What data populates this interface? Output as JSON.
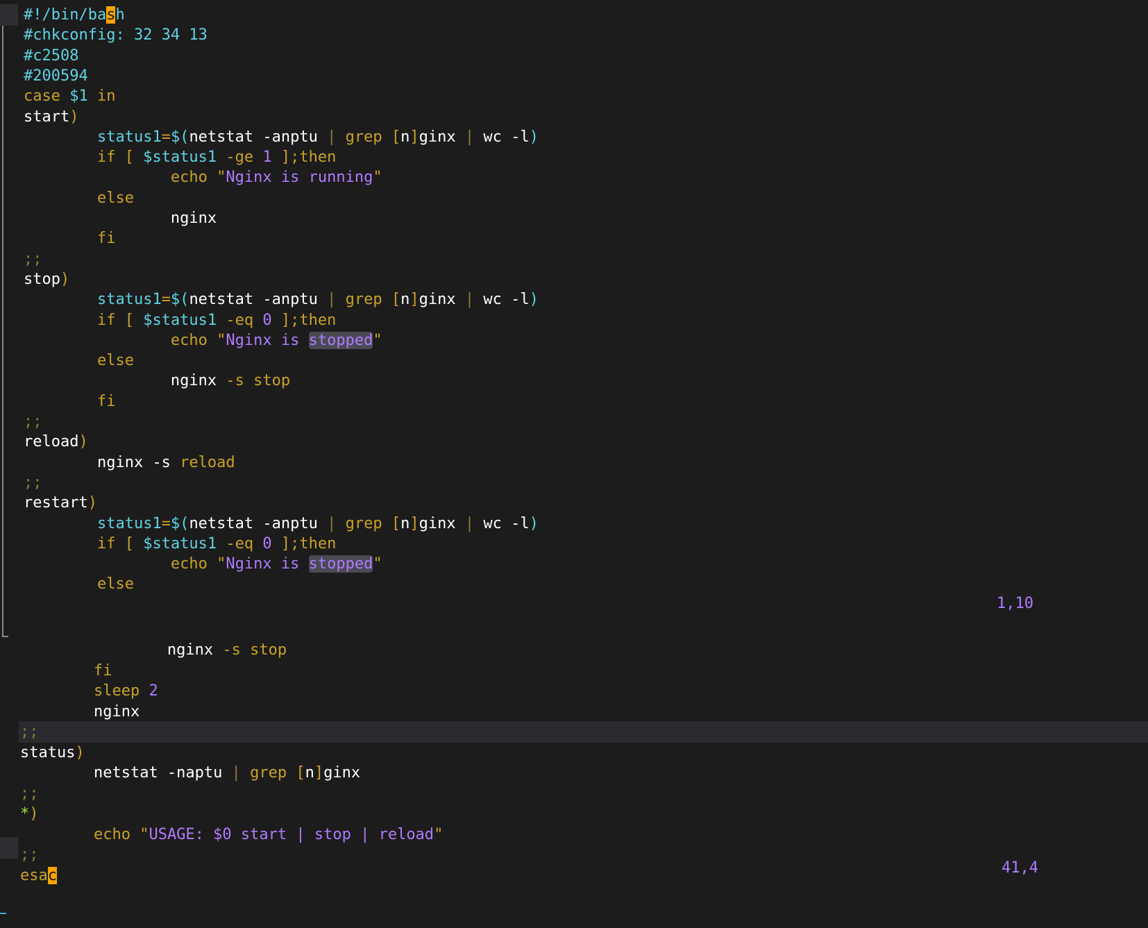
{
  "colors": {
    "background": "#1c1c1c",
    "comment": "#5fd3e3",
    "keyword": "#c9a227",
    "string_text": "#b07bff",
    "cursor": "#f5a300",
    "search_highlight": "#4a4a52"
  },
  "top_window": {
    "ruler": "1,10",
    "lines": [
      [
        {
          "t": "#!/bin/ba",
          "c": "cmt"
        },
        {
          "t": "s",
          "c": "cursor"
        },
        {
          "t": "h",
          "c": "cmt"
        }
      ],
      [
        {
          "t": "#chkconfig: 32 34 13",
          "c": "cmt"
        }
      ],
      [
        {
          "t": "#c2508",
          "c": "cmt"
        }
      ],
      [
        {
          "t": "#200594",
          "c": "cmt"
        }
      ],
      [
        {
          "t": "case ",
          "c": "kw"
        },
        {
          "t": "$1",
          "c": "var"
        },
        {
          "t": " in",
          "c": "kw"
        }
      ],
      [
        {
          "t": "start",
          "c": "fn"
        },
        {
          "t": ")",
          "c": "op"
        }
      ],
      [
        {
          "t": "        "
        },
        {
          "t": "status1",
          "c": "var"
        },
        {
          "t": "=",
          "c": "op"
        },
        {
          "t": "$(",
          "c": "var"
        },
        {
          "t": "netstat -anptu ",
          "c": "fn"
        },
        {
          "t": "|",
          "c": "dim"
        },
        {
          "t": " grep ",
          "c": "kw"
        },
        {
          "t": "[",
          "c": "op"
        },
        {
          "t": "n",
          "c": "fn"
        },
        {
          "t": "]",
          "c": "op"
        },
        {
          "t": "ginx ",
          "c": "fn"
        },
        {
          "t": "|",
          "c": "dim"
        },
        {
          "t": " wc -l",
          "c": "fn"
        },
        {
          "t": ")",
          "c": "var"
        }
      ],
      [
        {
          "t": "        "
        },
        {
          "t": "if [ ",
          "c": "kw"
        },
        {
          "t": "$status1",
          "c": "var"
        },
        {
          "t": " -ge ",
          "c": "kw"
        },
        {
          "t": "1",
          "c": "num"
        },
        {
          "t": " ];then",
          "c": "kw"
        }
      ],
      [
        {
          "t": "                "
        },
        {
          "t": "echo ",
          "c": "kw"
        },
        {
          "t": "\"",
          "c": "str"
        },
        {
          "t": "Nginx is running",
          "c": "strin"
        },
        {
          "t": "\"",
          "c": "str"
        }
      ],
      [
        {
          "t": "        "
        },
        {
          "t": "else",
          "c": "kw"
        }
      ],
      [
        {
          "t": "                "
        },
        {
          "t": "nginx",
          "c": "fn"
        }
      ],
      [
        {
          "t": "        "
        },
        {
          "t": "fi",
          "c": "kw"
        }
      ],
      [
        {
          "t": ";;",
          "c": "dim"
        }
      ],
      [
        {
          "t": "stop",
          "c": "fn"
        },
        {
          "t": ")",
          "c": "op"
        }
      ],
      [
        {
          "t": "        "
        },
        {
          "t": "status1",
          "c": "var"
        },
        {
          "t": "=",
          "c": "op"
        },
        {
          "t": "$(",
          "c": "var"
        },
        {
          "t": "netstat -anptu ",
          "c": "fn"
        },
        {
          "t": "|",
          "c": "dim"
        },
        {
          "t": " grep ",
          "c": "kw"
        },
        {
          "t": "[",
          "c": "op"
        },
        {
          "t": "n",
          "c": "fn"
        },
        {
          "t": "]",
          "c": "op"
        },
        {
          "t": "ginx ",
          "c": "fn"
        },
        {
          "t": "|",
          "c": "dim"
        },
        {
          "t": " wc -l",
          "c": "fn"
        },
        {
          "t": ")",
          "c": "var"
        }
      ],
      [
        {
          "t": "        "
        },
        {
          "t": "if [ ",
          "c": "kw"
        },
        {
          "t": "$status1",
          "c": "var"
        },
        {
          "t": " -eq ",
          "c": "kw"
        },
        {
          "t": "0",
          "c": "num"
        },
        {
          "t": " ];then",
          "c": "kw"
        }
      ],
      [
        {
          "t": "                "
        },
        {
          "t": "echo ",
          "c": "kw"
        },
        {
          "t": "\"",
          "c": "str"
        },
        {
          "t": "Nginx is ",
          "c": "strin"
        },
        {
          "t": "stopped",
          "c": "hl"
        },
        {
          "t": "\"",
          "c": "str"
        }
      ],
      [
        {
          "t": "        "
        },
        {
          "t": "else",
          "c": "kw"
        }
      ],
      [
        {
          "t": "                "
        },
        {
          "t": "nginx ",
          "c": "fn"
        },
        {
          "t": "-s stop",
          "c": "kw"
        }
      ],
      [
        {
          "t": "        "
        },
        {
          "t": "fi",
          "c": "kw"
        }
      ],
      [
        {
          "t": ";;",
          "c": "dim"
        }
      ],
      [
        {
          "t": "reload",
          "c": "fn"
        },
        {
          "t": ")",
          "c": "op"
        }
      ],
      [
        {
          "t": "        "
        },
        {
          "t": "nginx -s ",
          "c": "fn"
        },
        {
          "t": "reload",
          "c": "kw"
        }
      ],
      [
        {
          "t": ";;",
          "c": "dim"
        }
      ],
      [
        {
          "t": "restart",
          "c": "fn"
        },
        {
          "t": ")",
          "c": "op"
        }
      ],
      [
        {
          "t": "        "
        },
        {
          "t": "status1",
          "c": "var"
        },
        {
          "t": "=",
          "c": "op"
        },
        {
          "t": "$(",
          "c": "var"
        },
        {
          "t": "netstat -anptu ",
          "c": "fn"
        },
        {
          "t": "|",
          "c": "dim"
        },
        {
          "t": " grep ",
          "c": "kw"
        },
        {
          "t": "[",
          "c": "op"
        },
        {
          "t": "n",
          "c": "fn"
        },
        {
          "t": "]",
          "c": "op"
        },
        {
          "t": "ginx ",
          "c": "fn"
        },
        {
          "t": "|",
          "c": "dim"
        },
        {
          "t": " wc -l",
          "c": "fn"
        },
        {
          "t": ")",
          "c": "var"
        }
      ],
      [
        {
          "t": "        "
        },
        {
          "t": "if [ ",
          "c": "kw"
        },
        {
          "t": "$status1",
          "c": "var"
        },
        {
          "t": " -eq ",
          "c": "kw"
        },
        {
          "t": "0",
          "c": "num"
        },
        {
          "t": " ];then",
          "c": "kw"
        }
      ],
      [
        {
          "t": "                "
        },
        {
          "t": "echo ",
          "c": "kw"
        },
        {
          "t": "\"",
          "c": "str"
        },
        {
          "t": "Nginx is ",
          "c": "strin"
        },
        {
          "t": "stopped",
          "c": "hl"
        },
        {
          "t": "\"",
          "c": "str"
        }
      ],
      [
        {
          "t": "        "
        },
        {
          "t": "else",
          "c": "kw"
        }
      ]
    ]
  },
  "bottom_window": {
    "ruler": "41,4",
    "lines": [
      [
        {
          "t": "                "
        },
        {
          "t": "nginx ",
          "c": "fn"
        },
        {
          "t": "-s stop",
          "c": "kw"
        }
      ],
      [
        {
          "t": "        "
        },
        {
          "t": "fi",
          "c": "kw"
        }
      ],
      [
        {
          "t": "        "
        },
        {
          "t": "sleep ",
          "c": "kw"
        },
        {
          "t": "2",
          "c": "num"
        }
      ],
      [
        {
          "t": "        "
        },
        {
          "t": "nginx",
          "c": "fn"
        }
      ],
      [
        {
          "t": ";;",
          "c": "dim"
        }
      ],
      [
        {
          "t": "status",
          "c": "fn"
        },
        {
          "t": ")",
          "c": "op"
        }
      ],
      [
        {
          "t": "        "
        },
        {
          "t": "netstat -naptu ",
          "c": "fn"
        },
        {
          "t": "|",
          "c": "dim"
        },
        {
          "t": " grep ",
          "c": "kw"
        },
        {
          "t": "[",
          "c": "op"
        },
        {
          "t": "n",
          "c": "fn"
        },
        {
          "t": "]",
          "c": "op"
        },
        {
          "t": "ginx",
          "c": "fn"
        }
      ],
      [
        {
          "t": ";;",
          "c": "dim"
        }
      ],
      [
        {
          "t": "*",
          "c": "star"
        },
        {
          "t": ")",
          "c": "op"
        }
      ],
      [
        {
          "t": "        "
        },
        {
          "t": "echo ",
          "c": "kw"
        },
        {
          "t": "\"",
          "c": "str"
        },
        {
          "t": "USAGE: $0 start | stop | reload",
          "c": "strin"
        },
        {
          "t": "\"",
          "c": "str"
        }
      ],
      [
        {
          "t": ";;",
          "c": "dim"
        }
      ],
      [
        {
          "t": "esa",
          "c": "kw"
        },
        {
          "t": "c",
          "c": "cursor"
        }
      ]
    ]
  }
}
